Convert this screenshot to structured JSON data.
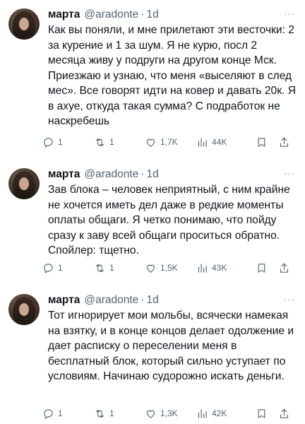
{
  "tweets": [
    {
      "name": "марта",
      "handle": "@aradonte",
      "sep": "·",
      "time": "1d",
      "text": "Как вы поняли, и мне прилетают эти весточки: 2 за курение и 1 за шум. Я не курю, посл 2 месяца живу у подруги на другом конце Мск. Приезжаю и узнаю, что меня «выселяют в след мес». Все говорят идти на ковер и давать 20к. Я в ахуе, откуда такая сумма? С подработок не наскребешь",
      "replies": "1",
      "retweets": "1",
      "likes": "1,7K",
      "views": "44K"
    },
    {
      "name": "марта",
      "handle": "@aradonte",
      "sep": "·",
      "time": "1d",
      "text": "Зав блока – человек неприятный, с ним крайне не хочется иметь дел даже в редкие моменты оплаты общаги. Я четко понимаю, что пойду сразу к заву всей общаги проситься обратно. Спойлер: тщетно.",
      "replies": "1",
      "retweets": "1",
      "likes": "1,5K",
      "views": "43K"
    },
    {
      "name": "марта",
      "handle": "@aradonte",
      "sep": "·",
      "time": "1d",
      "text": "Тот игнорирует мои мольбы, всячески намекая на взятку, и в конце концов делает одолжение и дает расписку о переселении меня в бесплатный блок, который сильно уступает по условиям. Начинаю судорожно искать деньги.",
      "replies": "1",
      "retweets": "1",
      "likes": "1,3K",
      "views": "42K"
    }
  ],
  "icons": {
    "more": "more-dots-icon",
    "reply": "reply-icon",
    "retweet": "retweet-icon",
    "like": "heart-icon",
    "views": "views-bar-chart-icon",
    "bookmark": "bookmark-icon",
    "share": "share-icon"
  },
  "colors": {
    "text": "#0f1419",
    "secondary": "#536471",
    "background": "#ffffff"
  }
}
